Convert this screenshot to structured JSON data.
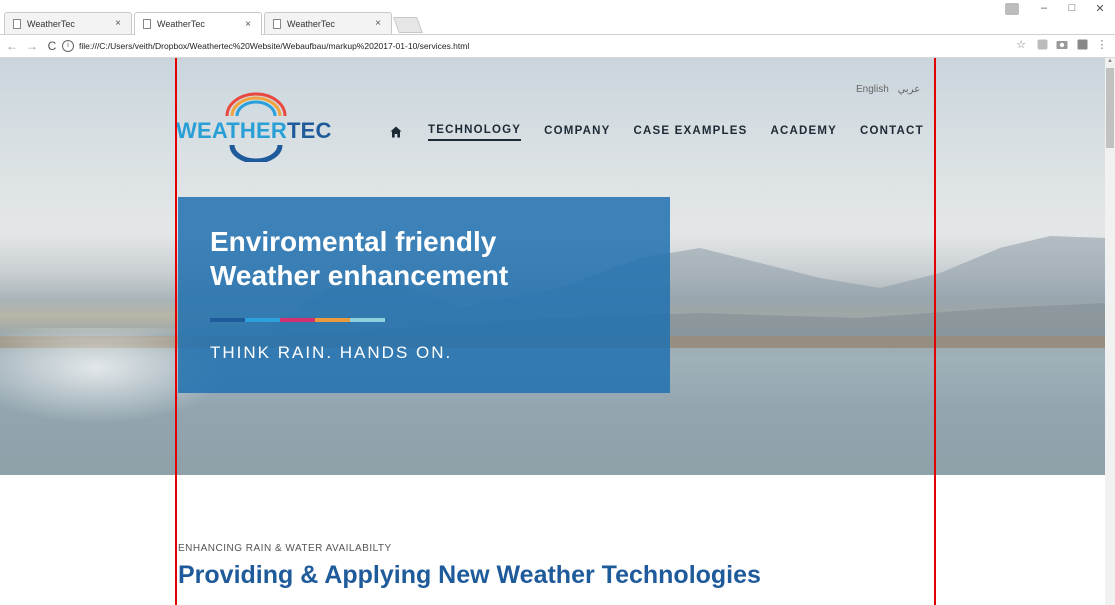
{
  "browser": {
    "tabs": [
      {
        "title": "WeatherTec",
        "close": "×"
      },
      {
        "title": "WeatherTec",
        "close": "×"
      },
      {
        "title": "WeatherTec",
        "close": "×"
      }
    ],
    "window_controls": {
      "minimize": "–",
      "maximize": "□",
      "close": "✕"
    },
    "nav": {
      "back": "←",
      "forward": "→",
      "reload": "C"
    },
    "url": "file:///C:/Users/veith/Dropbox/Weathertec%20Website/Webaufbau/markup%202017-01-10/services.html",
    "info_glyph": "i",
    "bookmark_glyph": "☆",
    "menu_glyph": "⋮"
  },
  "site": {
    "logo": {
      "weather": "WEATHER",
      "tec": "TEC"
    },
    "languages": [
      "English",
      "عربي"
    ],
    "nav": [
      {
        "label": "TECHNOLOGY",
        "active": true
      },
      {
        "label": "COMPANY",
        "active": false
      },
      {
        "label": "CASE EXAMPLES",
        "active": false
      },
      {
        "label": "ACADEMY",
        "active": false
      },
      {
        "label": "CONTACT",
        "active": false
      }
    ],
    "hero": {
      "title_line1": "Enviromental friendly",
      "title_line2": "Weather enhancement",
      "tagline": "THINK RAIN. HANDS ON.",
      "stripe_colors": [
        "#1f5b9a",
        "#2aa0dc",
        "#d2306f",
        "#e89a3c",
        "#8fd0df"
      ]
    },
    "section": {
      "kicker": "ENHANCING RAIN & WATER AVAILABILTY",
      "title": "Providing & Applying New Weather Technologies"
    }
  },
  "colors": {
    "brand_blue": "#1f5b9a",
    "brand_light_blue": "#2a9fd6",
    "hero_box": "#2171b0",
    "guide_lines": "#e30000"
  }
}
